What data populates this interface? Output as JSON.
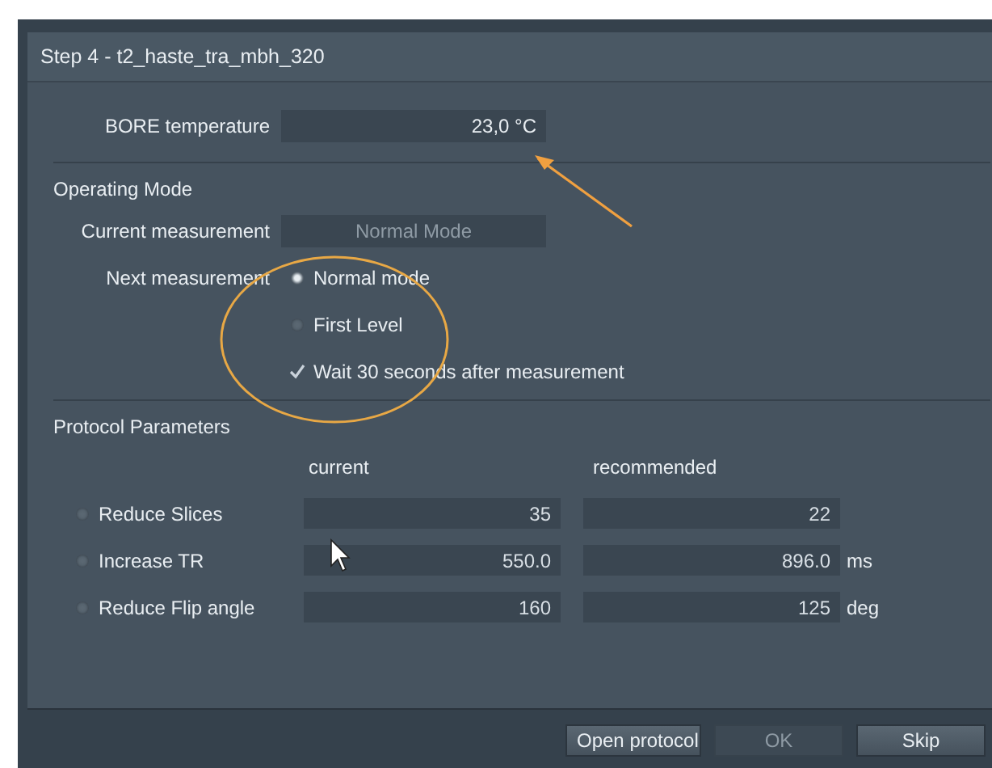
{
  "window": {
    "title": "Step 4 - t2_haste_tra_mbh_320"
  },
  "bore": {
    "label": "BORE temperature",
    "value": "23,0 °C"
  },
  "operating_mode": {
    "heading": "Operating Mode",
    "current_label": "Current measurement",
    "current_value": "Normal Mode",
    "next_label": "Next measurement",
    "options": [
      {
        "label": "Normal mode",
        "selected": true
      },
      {
        "label": "First Level",
        "selected": false
      }
    ],
    "wait": {
      "label": "Wait 30 seconds after measurement",
      "checked": true
    }
  },
  "protocol": {
    "heading": "Protocol Parameters",
    "columns": [
      "current",
      "recommended"
    ],
    "rows": [
      {
        "label": "Reduce Slices",
        "selected": false,
        "current": "35",
        "recommended": "22"
      },
      {
        "label": "Increase TR",
        "selected": false,
        "current": "550.0",
        "recommended": "896.0",
        "unit": "ms"
      },
      {
        "label": "Reduce Flip angle",
        "selected": false,
        "current": "160",
        "recommended": "125",
        "unit": "deg"
      }
    ]
  },
  "buttons": [
    {
      "label": "Open protocol",
      "disabled": false
    },
    {
      "label": "OK",
      "disabled": true
    },
    {
      "label": "Skip",
      "disabled": false
    }
  ]
}
